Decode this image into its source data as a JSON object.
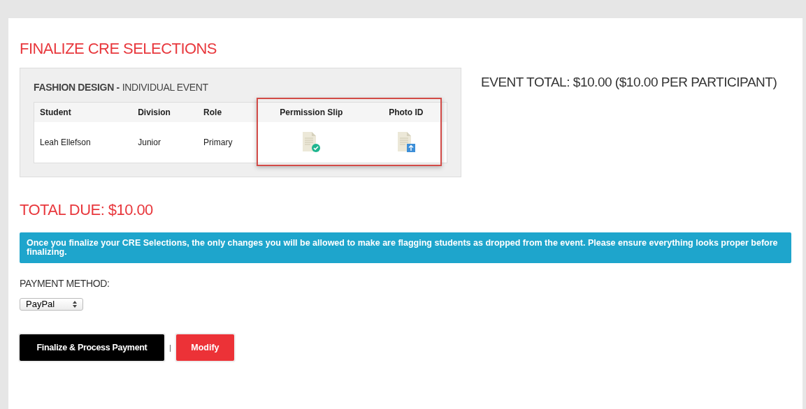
{
  "title": "FINALIZE CRE SELECTIONS",
  "event": {
    "name": "FASHION DESIGN -",
    "type": "INDIVIDUAL EVENT",
    "total": "EVENT TOTAL: $10.00 ($10.00 PER PARTICIPANT)",
    "columns": [
      "Student",
      "Division",
      "Role",
      "Permission Slip",
      "Photo ID"
    ],
    "documents_highlighted": true,
    "rows": [
      {
        "student": "Leah Ellefson",
        "division": "Junior",
        "role": "Primary",
        "documents": [
          {
            "kind": "approved"
          },
          {
            "kind": "upload"
          }
        ]
      }
    ]
  },
  "total_due": "TOTAL DUE: $10.00",
  "notice": "Once you finalize your CRE Selections, the only changes you will be allowed to make are flagging students as dropped from the event. Please ensure everything looks proper before finalizing.",
  "payment": {
    "label": "PAYMENT METHOD:",
    "value": "PayPal"
  },
  "buttons": [
    {
      "kind": "primary",
      "label": "Finalize & Process Payment"
    },
    {
      "kind": "separator",
      "label": "|"
    },
    {
      "kind": "danger",
      "label": "Modify"
    }
  ]
}
